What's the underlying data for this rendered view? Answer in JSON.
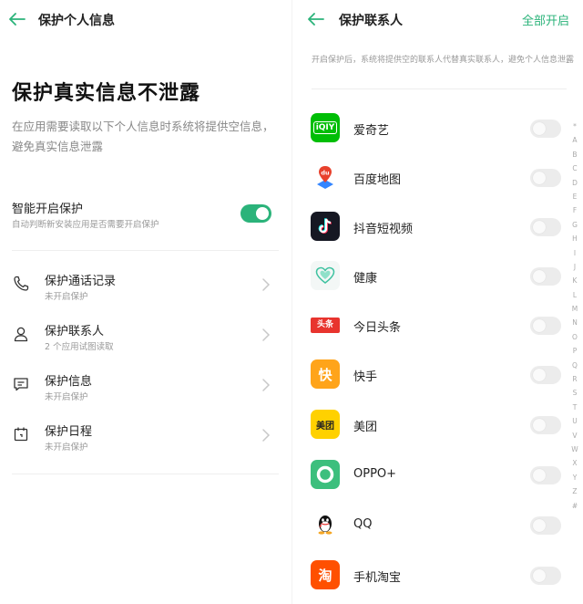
{
  "left": {
    "title": "保护个人信息",
    "hero_title": "保护真实信息不泄露",
    "hero_desc": "在应用需要读取以下个人信息时系统将提供空信息，避免真实信息泄露",
    "smart": {
      "title": "智能开启保护",
      "subtitle": "自动判断新安装应用是否需要开启保护",
      "enabled": true
    },
    "items": [
      {
        "label": "保护通话记录",
        "sub": "未开启保护",
        "icon": "phone-icon"
      },
      {
        "label": "保护联系人",
        "sub": "2 个应用试图读取",
        "icon": "person-icon"
      },
      {
        "label": "保护信息",
        "sub": "未开启保护",
        "icon": "message-icon"
      },
      {
        "label": "保护日程",
        "sub": "未开启保护",
        "icon": "calendar-icon"
      }
    ]
  },
  "right": {
    "title": "保护联系人",
    "action": "全部开启",
    "notice": "开启保护后，系统将提供空的联系人代替真实联系人，避免个人信息泄露",
    "apps": [
      {
        "label": "爱奇艺",
        "icon": "iqiyi-icon",
        "enabled": false
      },
      {
        "label": "百度地图",
        "icon": "baidu-map-icon",
        "enabled": false
      },
      {
        "label": "抖音短视频",
        "icon": "douyin-icon",
        "enabled": false
      },
      {
        "label": "健康",
        "icon": "health-icon",
        "enabled": false
      },
      {
        "label": "今日头条",
        "icon": "toutiao-icon",
        "enabled": false
      },
      {
        "label": "快手",
        "icon": "kuaishou-icon",
        "enabled": false
      },
      {
        "label": "美团",
        "icon": "meituan-icon",
        "enabled": false
      },
      {
        "label": "OPPO+",
        "icon": "oppo-plus-icon",
        "enabled": false
      },
      {
        "label": "QQ",
        "icon": "qq-icon",
        "enabled": false
      },
      {
        "label": "手机淘宝",
        "icon": "taobao-icon",
        "enabled": false
      }
    ],
    "app_icon_text": {
      "iqiyi": "iQIY",
      "baidu": "du",
      "toutiao": "头条",
      "kuaishou": "快",
      "meituan": "美团",
      "taobao": "淘"
    },
    "index": [
      "*",
      "A",
      "B",
      "C",
      "D",
      "E",
      "F",
      "G",
      "H",
      "I",
      "J",
      "K",
      "L",
      "M",
      "N",
      "O",
      "P",
      "Q",
      "R",
      "S",
      "T",
      "U",
      "V",
      "W",
      "X",
      "Y",
      "Z",
      "#"
    ]
  },
  "colors": {
    "accent": "#2bb37a",
    "toggle_off": "#ececec"
  }
}
